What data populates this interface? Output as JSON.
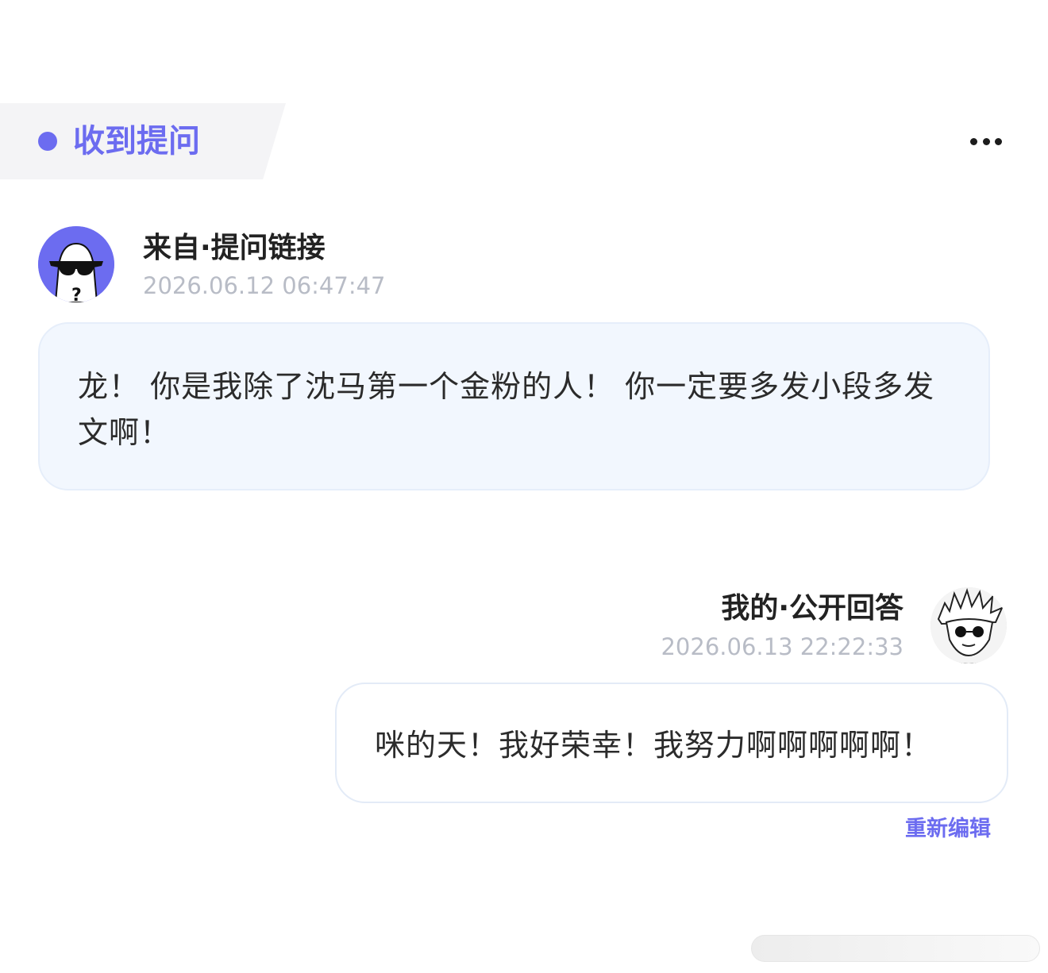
{
  "header": {
    "tag_label": "收到提问",
    "more_icon": "more-horizontal-icon",
    "accent_color": "#6c6cf0"
  },
  "question": {
    "sender": "来自·提问链接",
    "timestamp": "2026.06.12 06:47:47",
    "avatar": "anonymous-sunglasses-avatar",
    "text": "龙！ 你是我除了沈马第一个金粉的人！ 你一定要多发小段多发文啊！"
  },
  "answer": {
    "sender": "我的·公开回答",
    "timestamp": "2026.06.13 22:22:33",
    "avatar": "anime-character-avatar",
    "text": "咪的天！我好荣幸！我努力啊啊啊啊啊！",
    "edit_label": "重新编辑"
  }
}
